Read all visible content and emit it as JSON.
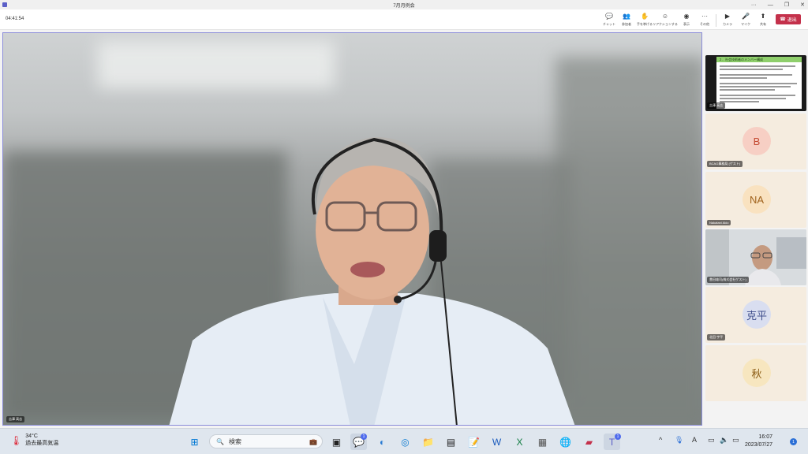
{
  "window": {
    "title": "7月月例会"
  },
  "toolbar": {
    "timer": "04:41:54",
    "buttons": [
      {
        "label": "チャット",
        "icon": "chat-icon"
      },
      {
        "label": "参加者",
        "icon": "people-icon"
      },
      {
        "label": "手を挙げる",
        "icon": "raise-hand-icon"
      },
      {
        "label": "リアクションする",
        "icon": "reaction-icon"
      },
      {
        "label": "表示",
        "icon": "view-icon"
      },
      {
        "label": "その他",
        "icon": "more-icon"
      },
      {
        "label": "カメラ",
        "icon": "camera-icon"
      },
      {
        "label": "マイク",
        "icon": "mic-icon"
      },
      {
        "label": "共有",
        "icon": "share-icon"
      }
    ],
    "leave_label": "退出"
  },
  "main": {
    "speaker_name": "吉澤 高志"
  },
  "participants": [
    {
      "name": "吉澤 高志",
      "kind": "slide",
      "slide_title": "２．社会技術者のメンバー構成"
    },
    {
      "name": "BCAO事務局 (ゲスト)",
      "initials": "B",
      "avatar_color": "#f7cfc4",
      "text_color": "#c44a32"
    },
    {
      "name": "Nakatani Akio",
      "initials": "NA",
      "avatar_color": "#f9e2c0",
      "text_color": "#a0621c"
    },
    {
      "name": "豊田雄司(株式会社ゲスト)",
      "kind": "video"
    },
    {
      "name": "北田 宇平",
      "initials": "克平",
      "avatar_color": "#d9def0",
      "text_color": "#3f4e8c"
    },
    {
      "name": "",
      "initials": "秋",
      "avatar_color": "#f7e6bf",
      "text_color": "#8a5a12"
    }
  ],
  "taskbar": {
    "temperature": "34°C",
    "weather_text": "過去最高気温",
    "search_placeholder": "検索",
    "teams_badge": "1",
    "teams2_badge": "1",
    "time": "16:07",
    "date": "2023/07/27",
    "notification_count": "1",
    "ime_label": "A"
  }
}
